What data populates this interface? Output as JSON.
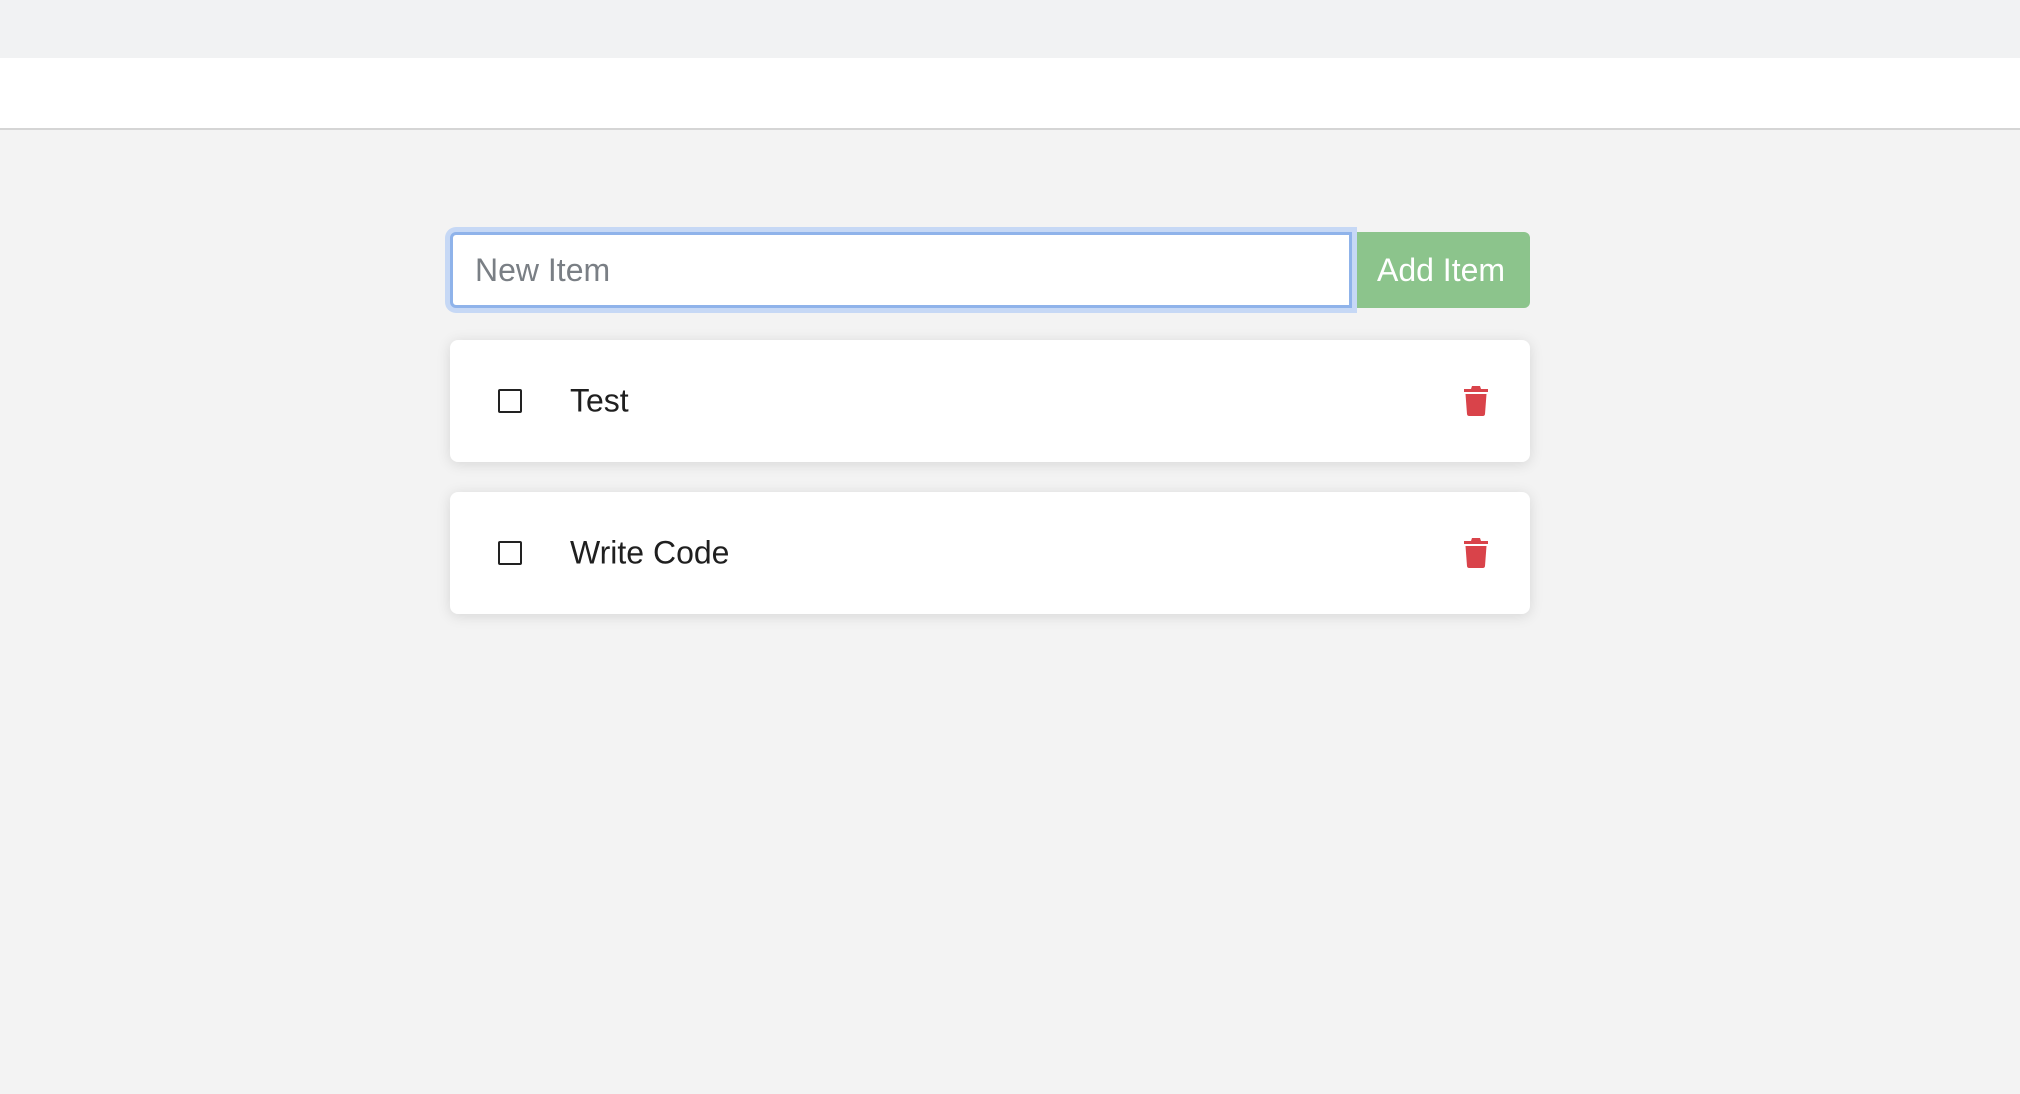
{
  "form": {
    "input_placeholder": "New Item",
    "input_value": "",
    "add_button_label": "Add Item"
  },
  "todos": [
    {
      "text": "Test",
      "checked": false
    },
    {
      "text": "Write Code",
      "checked": false
    }
  ],
  "icons": {
    "delete": "trash-icon",
    "checkbox": "checkbox-unchecked-icon"
  },
  "colors": {
    "page_background": "#f3f3f3",
    "navbar_background": "#ffffff",
    "add_button": "#8cc48c",
    "delete_icon": "#d9434a",
    "input_focus_border": "#8fb3ea"
  }
}
